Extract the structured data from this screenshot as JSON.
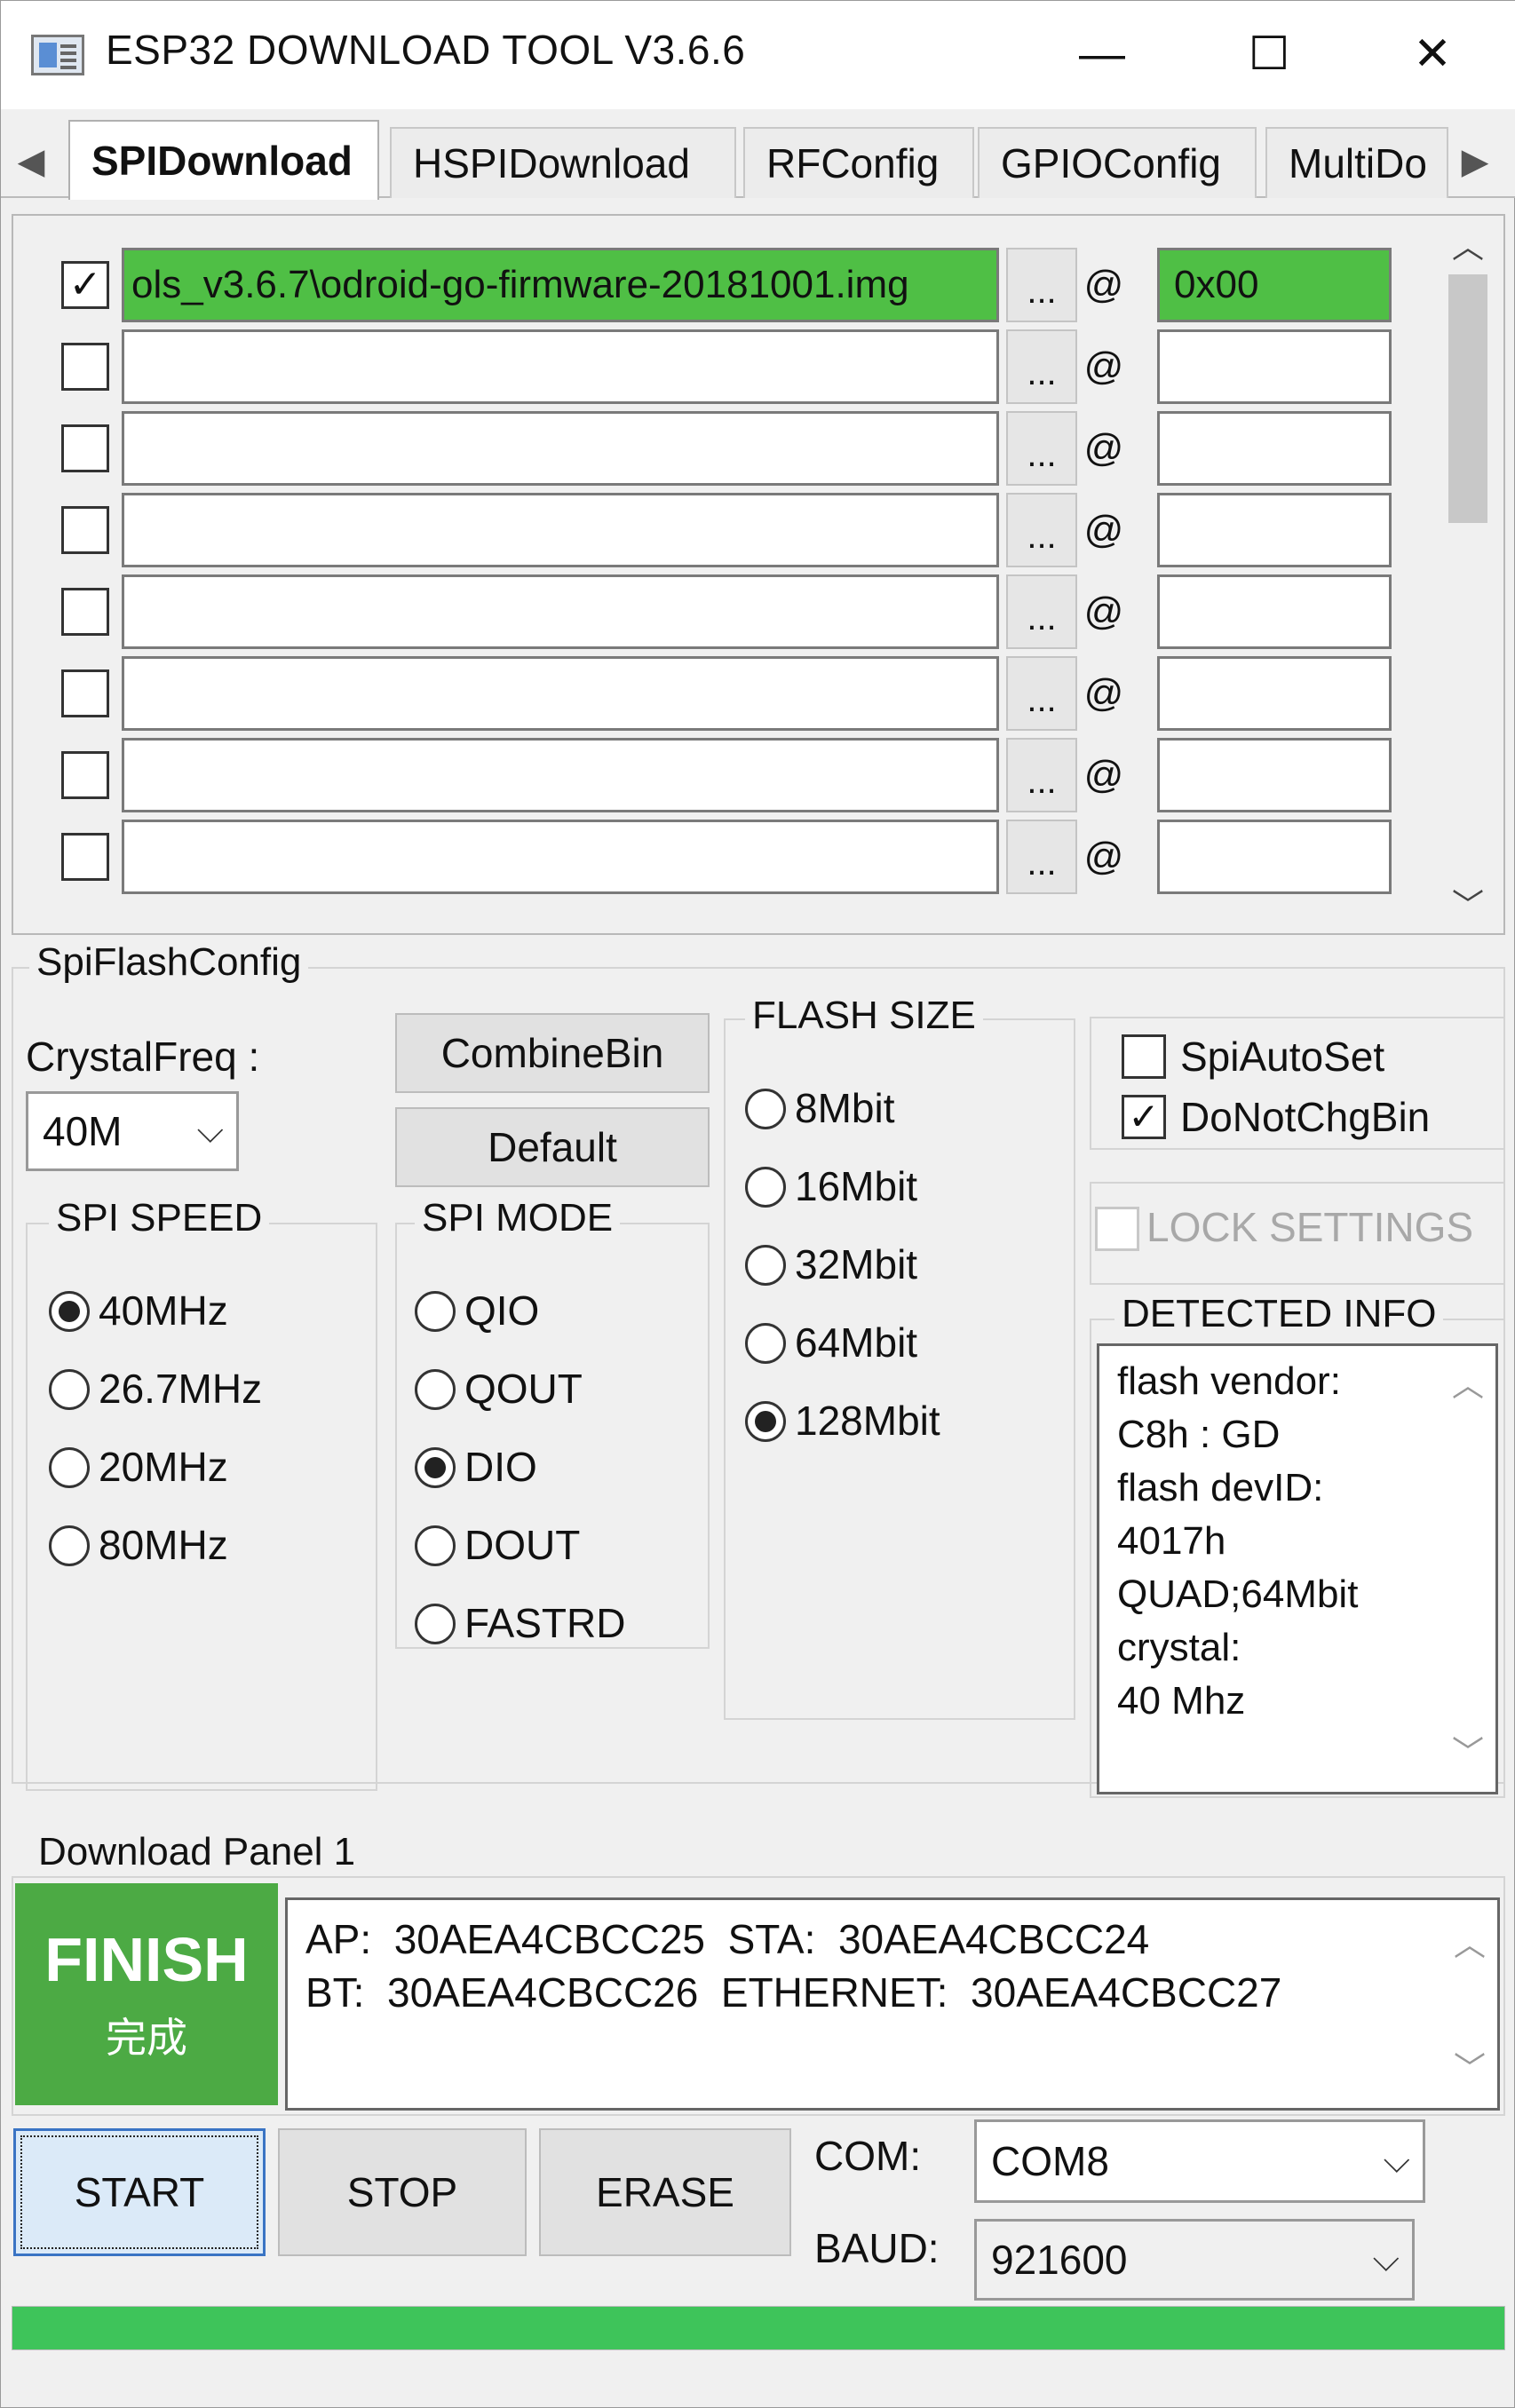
{
  "window": {
    "title": "ESP32 DOWNLOAD TOOL V3.6.6",
    "icons": {
      "app": "app-icon",
      "minimize": "minimize-icon",
      "maximize": "maximize-icon",
      "close": "close-icon"
    },
    "min_glyph": "—",
    "max_glyph": "☐",
    "close_glyph": "✕"
  },
  "tabs": [
    {
      "label": "SPIDownload",
      "active": true
    },
    {
      "label": "HSPIDownload",
      "active": false
    },
    {
      "label": "RFConfig",
      "active": false
    },
    {
      "label": "GPIOConfig",
      "active": false
    },
    {
      "label": "MultiDo",
      "active": false
    }
  ],
  "tab_arrows": {
    "left": "◀",
    "right": "▶"
  },
  "files": {
    "rows": [
      {
        "checked": true,
        "path": "ols_v3.6.7\\odroid-go-firmware-20181001.img",
        "address": "0x00",
        "highlight": true
      },
      {
        "checked": false,
        "path": "",
        "address": "",
        "highlight": false
      },
      {
        "checked": false,
        "path": "",
        "address": "",
        "highlight": false
      },
      {
        "checked": false,
        "path": "",
        "address": "",
        "highlight": false
      },
      {
        "checked": false,
        "path": "",
        "address": "",
        "highlight": false
      },
      {
        "checked": false,
        "path": "",
        "address": "",
        "highlight": false
      },
      {
        "checked": false,
        "path": "",
        "address": "",
        "highlight": false
      },
      {
        "checked": false,
        "path": "",
        "address": "",
        "highlight": false
      }
    ],
    "browse_label": "...",
    "at_label": "@",
    "check_glyph": "✓"
  },
  "spi_flash_config": {
    "label": "SpiFlashConfig",
    "crystal_label": "CrystalFreq :",
    "crystal_value": "40M",
    "combine_bin": "CombineBin",
    "default": "Default",
    "spi_speed": {
      "label": "SPI SPEED",
      "options": [
        {
          "label": "40MHz",
          "selected": true
        },
        {
          "label": "26.7MHz",
          "selected": false
        },
        {
          "label": "20MHz",
          "selected": false
        },
        {
          "label": "80MHz",
          "selected": false
        }
      ]
    },
    "spi_mode": {
      "label": "SPI MODE",
      "options": [
        {
          "label": "QIO",
          "selected": false
        },
        {
          "label": "QOUT",
          "selected": false
        },
        {
          "label": "DIO",
          "selected": true
        },
        {
          "label": "DOUT",
          "selected": false
        },
        {
          "label": "FASTRD",
          "selected": false
        }
      ]
    },
    "flash_size": {
      "label": "FLASH SIZE",
      "options": [
        {
          "label": "8Mbit",
          "selected": false
        },
        {
          "label": "16Mbit",
          "selected": false
        },
        {
          "label": "32Mbit",
          "selected": false
        },
        {
          "label": "64Mbit",
          "selected": false
        },
        {
          "label": "128Mbit",
          "selected": true
        }
      ]
    },
    "spi_auto_set": {
      "label": "SpiAutoSet",
      "checked": false
    },
    "do_not_chg_bin": {
      "label": "DoNotChgBin",
      "checked": true
    },
    "lock_settings": {
      "label": "LOCK SETTINGS",
      "checked": false,
      "disabled": true
    },
    "detected_info": {
      "label": "DETECTED INFO",
      "lines": [
        "flash vendor:",
        "C8h : GD",
        "flash devID:",
        "4017h",
        "QUAD;64Mbit",
        "crystal:",
        "40 Mhz"
      ]
    }
  },
  "download_panel": {
    "label": "Download Panel 1",
    "status": "FINISH",
    "status_sub": "完成",
    "mac_lines": [
      "AP:  30AEA4CBCC25  STA:  30AEA4CBCC24",
      "BT:  30AEA4CBCC26  ETHERNET:  30AEA4CBCC27"
    ],
    "start": "START",
    "stop": "STOP",
    "erase": "ERASE",
    "com_label": "COM:",
    "com_value": "COM8",
    "baud_label": "BAUD:",
    "baud_value": "921600",
    "progress": 1.0
  },
  "colors": {
    "success_green": "#4caa44",
    "path_green": "#4fbf45",
    "progress_green": "#3ec45a"
  }
}
